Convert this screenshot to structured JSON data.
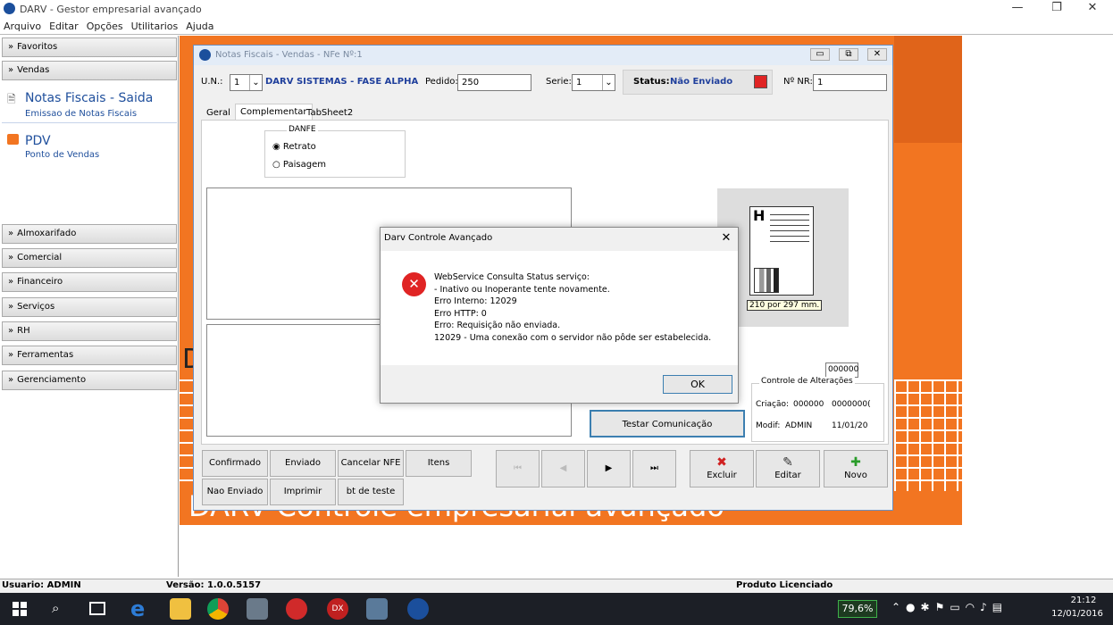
{
  "app": {
    "title": "DARV - Gestor empresarial avançado",
    "menu": [
      "Arquivo",
      "Editar",
      "Opções",
      "Utilitarios",
      "Ajuda"
    ],
    "window_controls": {
      "minimize": "—",
      "restore": "❐",
      "close": "✕"
    }
  },
  "sidebar": {
    "favoritos": "Favoritos",
    "vendas": "Vendas",
    "nf_title": "Notas Fiscais - Saida",
    "nf_sub": "Emissao de Notas Fiscais",
    "pdv_title": "PDV",
    "pdv_sub": "Ponto de Vendas",
    "sections": [
      "Almoxarifado",
      "Comercial",
      "Financeiro",
      "Serviços",
      "RH",
      "Ferramentas",
      "Gerenciamento"
    ]
  },
  "background": {
    "slogan": "DARV Controle empresarial avançado",
    "d_letter": "D"
  },
  "nfe": {
    "title": "Notas Fiscais - Vendas - NFe Nº:1",
    "un_label": "U.N.:",
    "un_value": "1",
    "company": "DARV SISTEMAS - FASE ALPHA",
    "pedido_label": "Pedido:",
    "pedido_value": "250",
    "serie_label": "Serie:",
    "serie_value": "1",
    "status_label": "Status:",
    "status_value": "Não Enviado",
    "nr_label": "Nº NR:",
    "nr_value": "1",
    "tabs": [
      "Geral",
      "Complementar",
      "TabSheet2"
    ],
    "danfe": "DANFE",
    "retrato": "Retrato",
    "paisagem": "Paisagem",
    "paper_size": "210 por 297 mm.",
    "small_code": "000000",
    "controle": "Controle de Alterações",
    "criacao_label": "Criação:",
    "criacao_user": "000000",
    "criacao_date": "0000000(",
    "modif_label": "Modif:",
    "modif_user": "ADMIN",
    "modif_date": "11/01/20",
    "testar": "Testar Comunicação",
    "buttons_row1": [
      "Confirmado",
      "Enviado",
      "Cancelar NFE",
      "Itens"
    ],
    "buttons_row2": [
      "Nao Enviado",
      "Imprimir",
      "bt de teste"
    ],
    "nav": [
      "⏮",
      "◀",
      "▶",
      "⏭"
    ],
    "excluir": "Excluir",
    "editar": "Editar",
    "novo": "Novo"
  },
  "dialog": {
    "title": "Darv Controle Avançado",
    "close": "✕",
    "lines": [
      "WebService Consulta Status serviço:",
      "- Inativo ou Inoperante tente novamente.",
      "Erro Interno: 12029",
      "Erro HTTP: 0",
      "Erro: Requisição não enviada.",
      "12029 - Uma conexão com o servidor não pôde ser estabelecida."
    ],
    "ok": "OK"
  },
  "statusbar": {
    "user": "Usuario: ADMIN",
    "version": "Versão: 1.0.0.5157",
    "license": "Produto Licenciado"
  },
  "taskbar": {
    "battery": "79,6%",
    "time": "21:12",
    "date": "12/01/2016"
  },
  "colors": {
    "accent": "#f27521",
    "status_red": "#e02424",
    "link_blue": "#1f4f9c"
  }
}
